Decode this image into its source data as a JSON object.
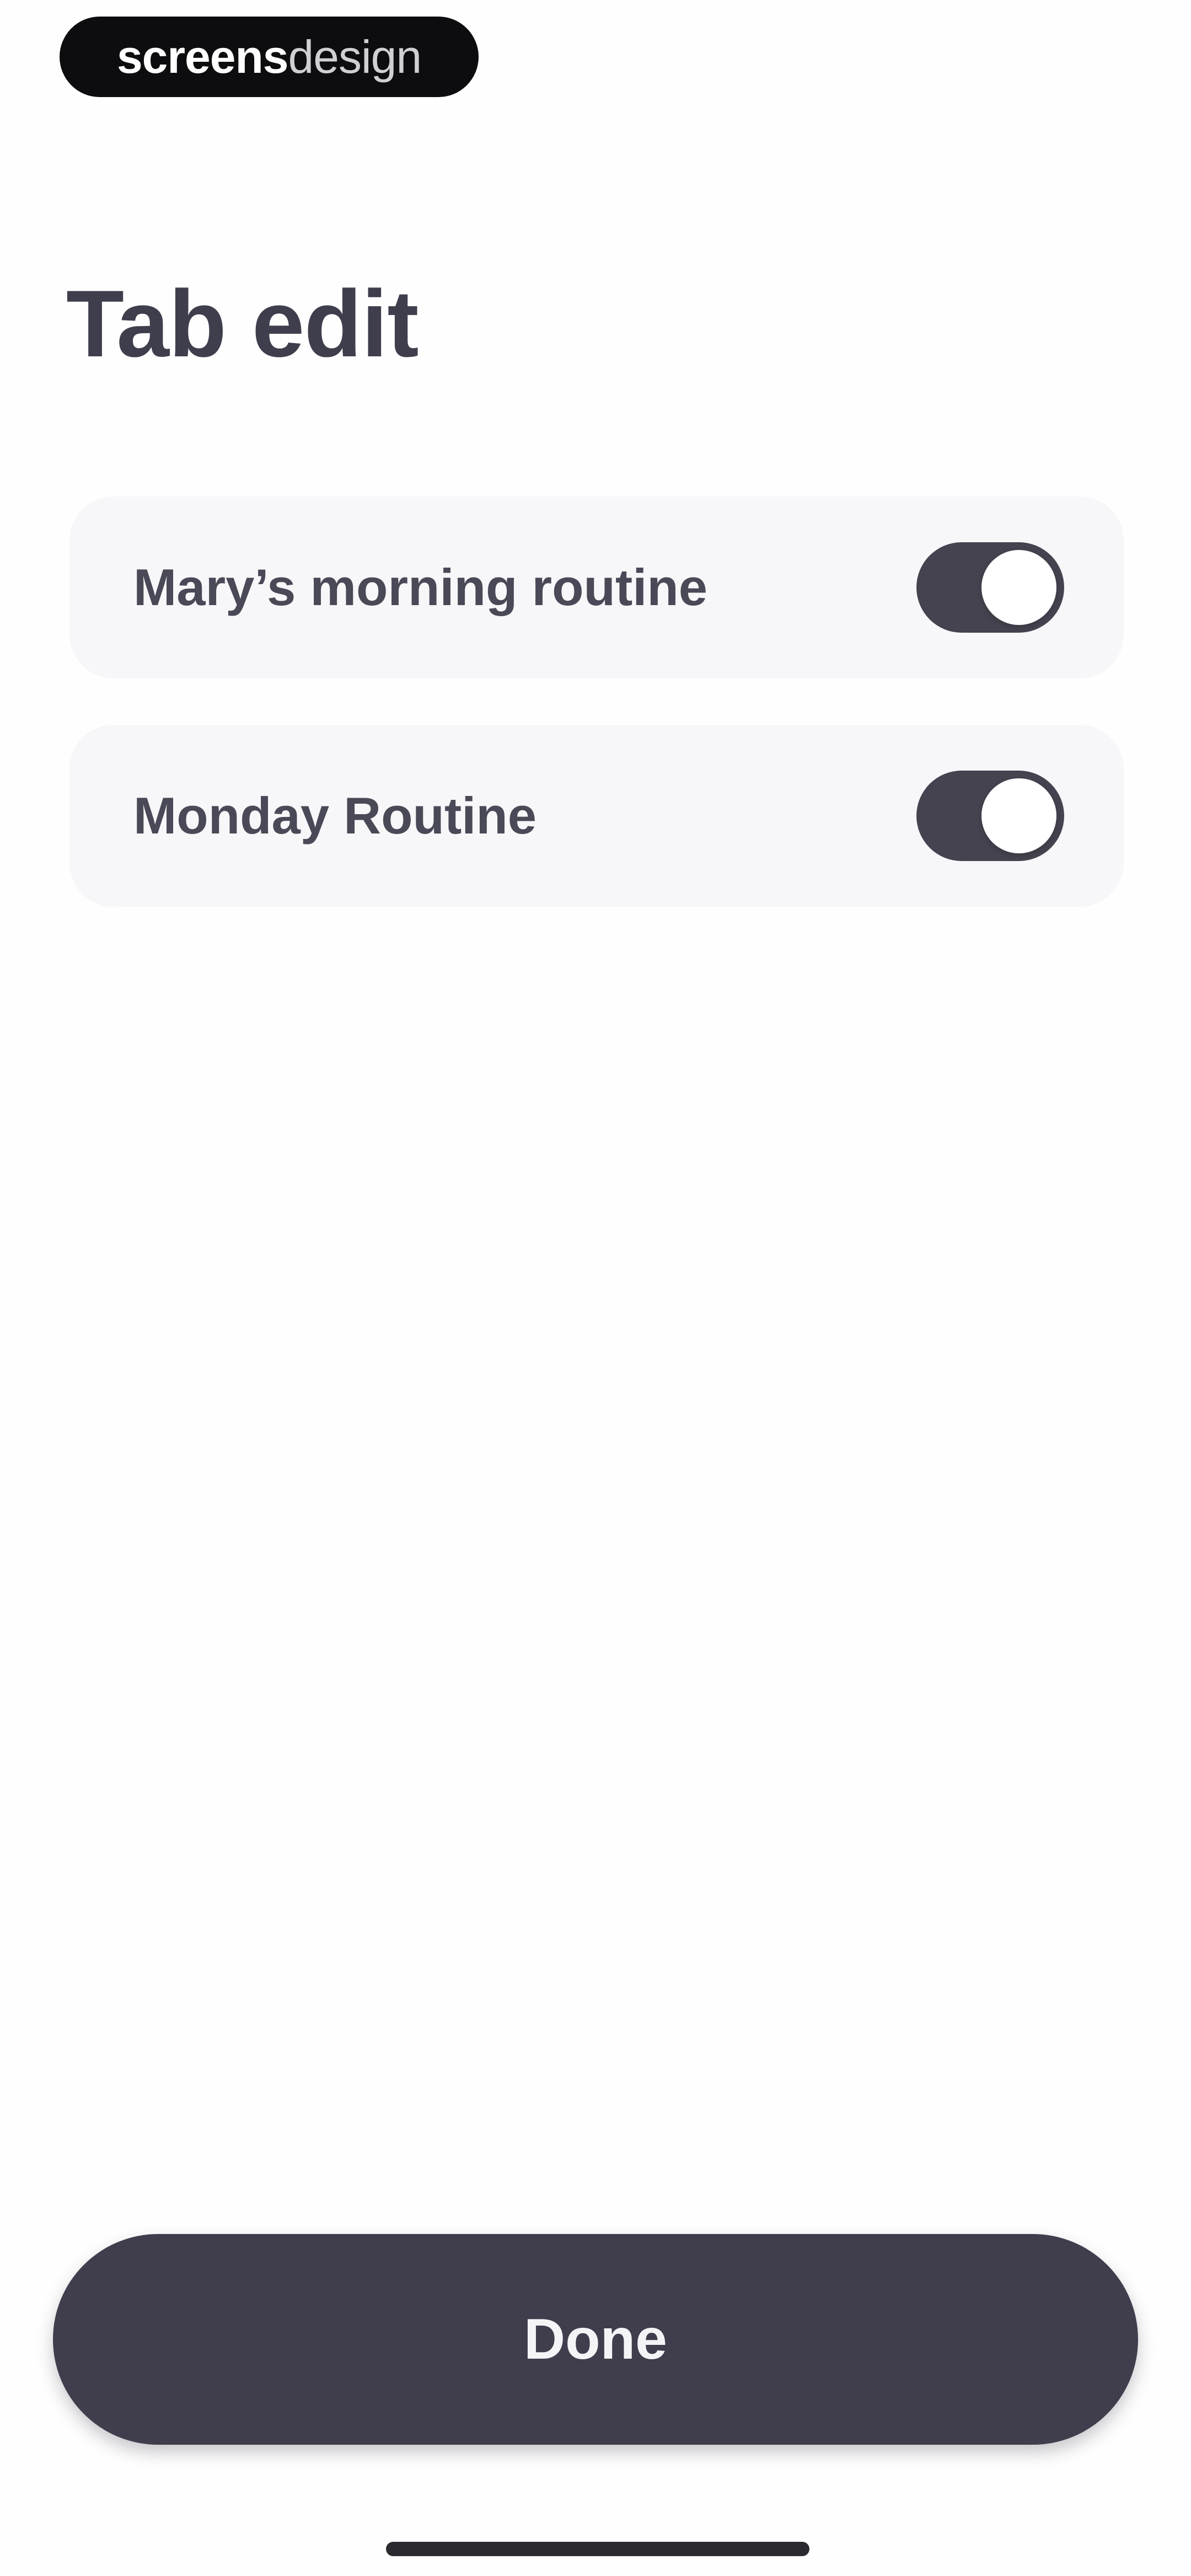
{
  "brand": {
    "part1": "screens",
    "part2": "design"
  },
  "page": {
    "title": "Tab edit"
  },
  "routines": [
    {
      "label": "Mary’s morning routine",
      "enabled": true
    },
    {
      "label": "Monday Routine",
      "enabled": true
    }
  ],
  "footer": {
    "done_label": "Done"
  },
  "colors": {
    "title_text": "#3f3e4c",
    "toggle_on": "#45434f",
    "button_bg": "#403d4d",
    "card_bg": "#f7f7f9"
  }
}
